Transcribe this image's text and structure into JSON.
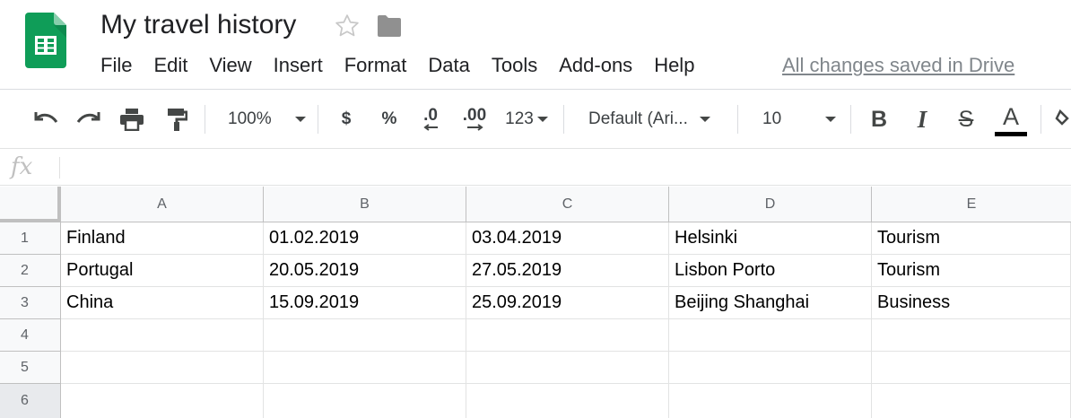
{
  "app": {
    "title": "My travel history",
    "save_status": "All changes saved in Drive",
    "colors": {
      "sheets_green": "#0f9d58",
      "text": "#202124",
      "muted": "#80868b"
    }
  },
  "menu": [
    "File",
    "Edit",
    "View",
    "Insert",
    "Format",
    "Data",
    "Tools",
    "Add-ons",
    "Help"
  ],
  "toolbar": {
    "zoom": "100%",
    "currency": "$",
    "percent": "%",
    "decrease_decimal": ".0",
    "increase_decimal": ".00",
    "more_formats": "123",
    "font": "Default (Ari...",
    "font_size": "10",
    "bold": "B",
    "italic": "I",
    "strikethrough": "S",
    "text_color": "A",
    "icons": [
      "undo-icon",
      "redo-icon",
      "print-icon",
      "paint-format-icon",
      "fill-color-icon"
    ]
  },
  "formula_bar": {
    "label": "fx",
    "value": ""
  },
  "grid": {
    "columns": [
      "A",
      "B",
      "C",
      "D",
      "E"
    ],
    "rows": [
      "1",
      "2",
      "3",
      "4",
      "5",
      "6"
    ],
    "cells": [
      [
        "Finland",
        "01.02.2019",
        "03.04.2019",
        "Helsinki",
        "Tourism"
      ],
      [
        "Portugal",
        "20.05.2019",
        "27.05.2019",
        "Lisbon Porto",
        "Tourism"
      ],
      [
        "China",
        "15.09.2019",
        "25.09.2019",
        "Beijing Shanghai",
        "Business"
      ],
      [
        "",
        "",
        "",
        "",
        ""
      ],
      [
        "",
        "",
        "",
        "",
        ""
      ],
      [
        "",
        "",
        "",
        "",
        ""
      ]
    ]
  }
}
